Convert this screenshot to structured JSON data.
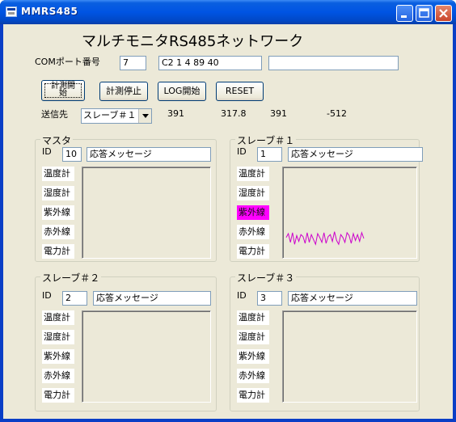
{
  "window": {
    "title": "MMRS485"
  },
  "heading": "マルチモニタRS485ネットワーク",
  "com": {
    "label": "COMポート番号",
    "port": "7",
    "hex": "C2 1 4 89 40",
    "extra": ""
  },
  "buttons": {
    "measure_start_line1": "計測開",
    "measure_start_line2": "始",
    "measure_stop": "計測停止",
    "log_start": "LOG開始",
    "reset": "RESET"
  },
  "destination": {
    "label": "送信先",
    "value": "スレーブ＃１"
  },
  "readouts": [
    "391",
    "317.8",
    "391",
    "-512"
  ],
  "panels": [
    {
      "title": "マスタ",
      "id_label": "ID",
      "id": "10",
      "message": "応答メッセージ",
      "sensors": [
        "温度計",
        "湿度計",
        "紫外線",
        "赤外線",
        "電力計"
      ],
      "active_sensor": -1,
      "waveform": []
    },
    {
      "title": "スレーブ＃１",
      "id_label": "ID",
      "id": "1",
      "message": "応答メッセージ",
      "sensors": [
        "温度計",
        "湿度計",
        "紫外線",
        "赤外線",
        "電力計"
      ],
      "active_sensor": 2,
      "waveform_color": "#cc00cc",
      "waveform": [
        0.55,
        0.75,
        0.3,
        0.8,
        0.2,
        0.65,
        0.35,
        0.7,
        0.6,
        0.25,
        0.8,
        0.3,
        0.7,
        0.45,
        0.2,
        0.75,
        0.55,
        0.3,
        0.8,
        0.25,
        0.6,
        0.7,
        0.35,
        0.85,
        0.4,
        0.2,
        0.7,
        0.55,
        0.3,
        0.8,
        0.65,
        0.25,
        0.75,
        0.4,
        0.7,
        0.35,
        0.8,
        0.5
      ]
    },
    {
      "title": "スレーブ＃２",
      "id_label": "ID",
      "id": "2",
      "message": "応答メッセージ",
      "sensors": [
        "温度計",
        "湿度計",
        "紫外線",
        "赤外線",
        "電力計"
      ],
      "active_sensor": -1,
      "waveform": []
    },
    {
      "title": "スレーブ＃３",
      "id_label": "ID",
      "id": "3",
      "message": "応答メッセージ",
      "sensors": [
        "温度計",
        "湿度計",
        "紫外線",
        "赤外線",
        "電力計"
      ],
      "active_sensor": -1,
      "waveform": []
    }
  ]
}
